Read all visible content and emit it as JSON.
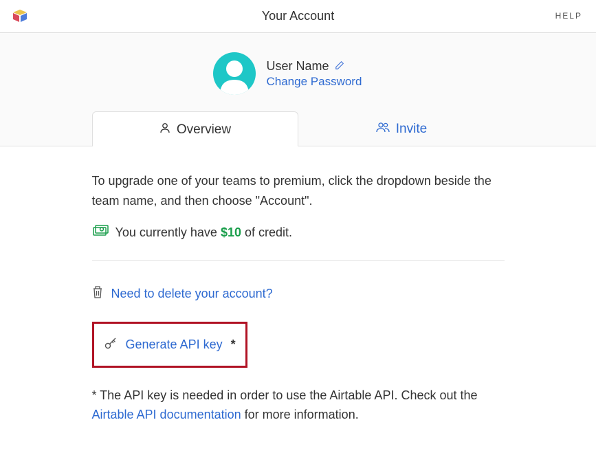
{
  "header": {
    "title": "Your Account",
    "help": "HELP"
  },
  "profile": {
    "user_name": "User Name",
    "change_password": "Change Password"
  },
  "tabs": {
    "overview": "Overview",
    "invite": "Invite"
  },
  "content": {
    "upgrade_text": "To upgrade one of your teams to premium, click the dropdown beside the team name, and then choose \"Account\".",
    "credit_prefix": "You currently have ",
    "credit_amount": "$10",
    "credit_suffix": " of credit.",
    "delete_account": "Need to delete your account?",
    "generate_api": "Generate API key",
    "asterisk": "*",
    "footnote_prefix": "* The API key is needed in order to use the Airtable API. Check out the ",
    "footnote_link": "Airtable API documentation",
    "footnote_suffix": " for more information."
  }
}
